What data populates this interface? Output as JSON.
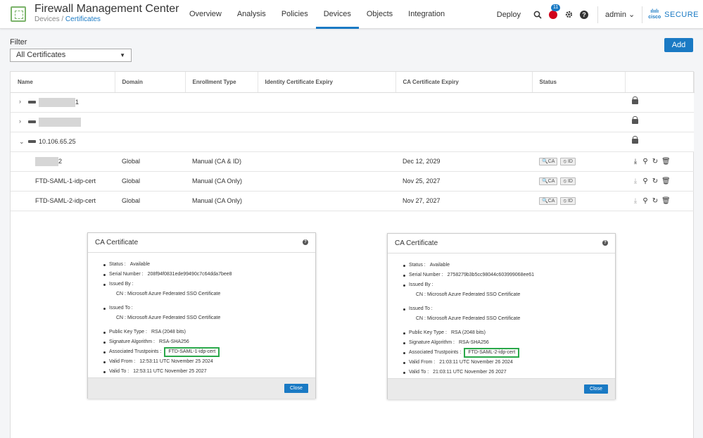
{
  "header": {
    "app_title": "Firewall Management Center",
    "breadcrumb_parent": "Devices",
    "breadcrumb_sep": "/",
    "breadcrumb_current": "Certificates",
    "nav": [
      "Overview",
      "Analysis",
      "Policies",
      "Devices",
      "Objects",
      "Integration"
    ],
    "deploy": "Deploy",
    "alert_count": "11",
    "help": "?",
    "user": "admin",
    "brand_mark": "cisco",
    "brand": "SECURE"
  },
  "filter": {
    "label": "Filter",
    "value": "All Certificates"
  },
  "add_label": "Add",
  "table": {
    "columns": [
      "Name",
      "Domain",
      "Enrollment Type",
      "Identity Certificate Expiry",
      "CA Certificate Expiry",
      "Status"
    ],
    "groups": [
      {
        "name_suffix": "1"
      },
      {
        "name_suffix": ""
      },
      {
        "name_suffix": "10.106.65.25"
      }
    ],
    "rows": [
      {
        "name": "2",
        "domain": "Global",
        "enrollment": "Manual (CA & ID)",
        "identity_expiry": "",
        "ca_expiry": "Dec 12, 2029",
        "status_ca": "CA",
        "status_id": "ID"
      },
      {
        "name": "FTD-SAML-1-idp-cert",
        "domain": "Global",
        "enrollment": "Manual (CA Only)",
        "identity_expiry": "",
        "ca_expiry": "Nov 25, 2027",
        "status_ca": "CA",
        "status_id": "ID"
      },
      {
        "name": "FTD-SAML-2-idp-cert",
        "domain": "Global",
        "enrollment": "Manual (CA Only)",
        "identity_expiry": "",
        "ca_expiry": "Nov 27, 2027",
        "status_ca": "CA",
        "status_id": "ID"
      }
    ]
  },
  "dialogs": [
    {
      "title": "CA Certificate",
      "status_label": "Status :",
      "status": "Available",
      "serial_label": "Serial Number :",
      "serial": "208f94f0831ede99490c7c64dda7bee8",
      "issued_by_label": "Issued By :",
      "issued_by_cn_label": "CN :",
      "issued_by_cn": "Microsoft Azure Federated SSO Certificate",
      "issued_to_label": "Issued To :",
      "issued_to_cn_label": "CN :",
      "issued_to_cn": "Microsoft Azure Federated SSO Certificate",
      "pk_label": "Public Key Type :",
      "pk": "RSA (2048 bits)",
      "sig_label": "Signature Algorithm :",
      "sig": "RSA-SHA256",
      "tp_label": "Associated Trustpoints :",
      "tp": "FTD-SAML-1-idp-cert",
      "from_label": "Valid From :",
      "from": "12:53:11 UTC November 25 2024",
      "to_label": "Valid To :",
      "to": "12:53:11 UTC November 25 2027",
      "close": "Close"
    },
    {
      "title": "CA Certificate",
      "status_label": "Status :",
      "status": "Available",
      "serial_label": "Serial Number :",
      "serial": "2758279b3b5cc98044c603999068ee61",
      "issued_by_label": "Issued By :",
      "issued_by_cn_label": "CN :",
      "issued_by_cn": "Microsoft Azure Federated SSO Certificate",
      "issued_to_label": "Issued To :",
      "issued_to_cn_label": "CN :",
      "issued_to_cn": "Microsoft Azure Federated SSO Certificate",
      "pk_label": "Public Key Type :",
      "pk": "RSA (2048 bits)",
      "sig_label": "Signature Algorithm :",
      "sig": "RSA-SHA256",
      "tp_label": "Associated Trustpoints :",
      "tp": "FTD-SAML-2-idp-cert",
      "from_label": "Valid From :",
      "from": "21:03:11 UTC November 26 2024",
      "to_label": "Valid To :",
      "to": "21:03:11 UTC November 26 2027",
      "close": "Close"
    }
  ],
  "icons": {
    "search": "search-icon",
    "alert": "alert-icon",
    "settings": "gear-icon",
    "help": "help-icon",
    "lock": "lock-icon",
    "download": "download-icon",
    "re-enroll": "re-enroll-icon",
    "refresh": "refresh-icon",
    "delete": "trash-icon"
  },
  "colors": {
    "accent": "#1a7ac4",
    "alert": "#d0021b",
    "trustpoint_highlight": "#2aa84a"
  }
}
